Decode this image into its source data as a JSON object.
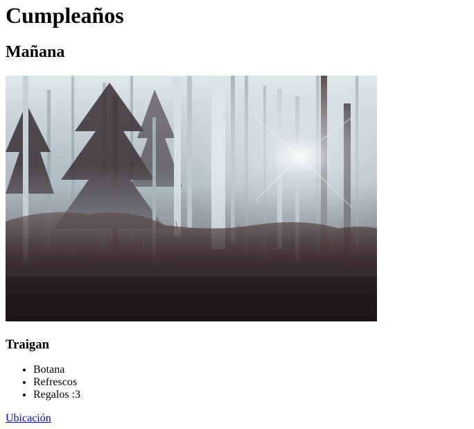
{
  "page": {
    "title": "Cumpleaños",
    "subtitle": "Mañana"
  },
  "hero_image": {
    "subject": "misty forest with sunlight through trees",
    "colors": {
      "sky": "#d9e2e6",
      "mist": "#b9c6cc",
      "trunk_light": "#c8d4da",
      "trunk_dark": "#3b2f33",
      "undergrowth": "#4a3a3a",
      "ground": "#241c1e"
    }
  },
  "bring_section": {
    "heading": "Traigan",
    "items": [
      {
        "label": "Botana"
      },
      {
        "label": "Refrescos"
      },
      {
        "label": "Regalos :3"
      }
    ]
  },
  "location_link": {
    "label": "Ubicación",
    "color": "#0000ee"
  }
}
